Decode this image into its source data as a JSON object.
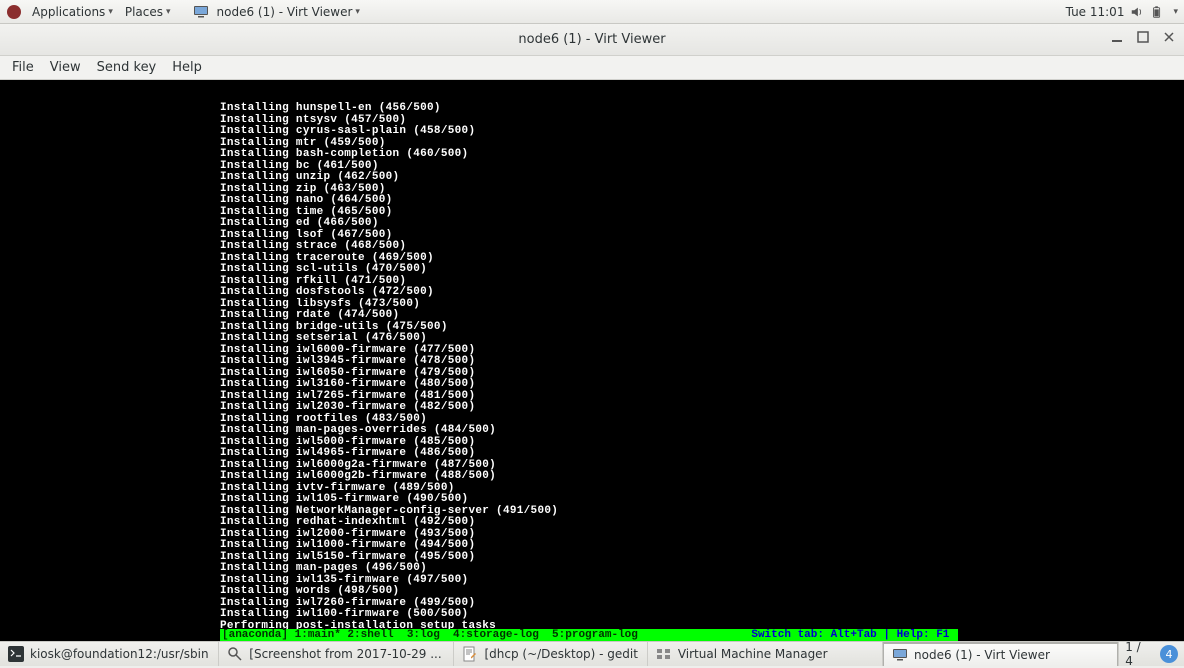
{
  "top_panel": {
    "applications": "Applications",
    "places": "Places",
    "running_window": "node6 (1) - Virt Viewer",
    "clock": "Tue 11:01"
  },
  "window": {
    "title": "node6 (1) - Virt Viewer",
    "menus": [
      "File",
      "View",
      "Send key",
      "Help"
    ]
  },
  "console": {
    "lines": [
      "Installing hunspell-en (456/500)",
      "Installing ntsysv (457/500)",
      "Installing cyrus-sasl-plain (458/500)",
      "Installing mtr (459/500)",
      "Installing bash-completion (460/500)",
      "Installing bc (461/500)",
      "Installing unzip (462/500)",
      "Installing zip (463/500)",
      "Installing nano (464/500)",
      "Installing time (465/500)",
      "Installing ed (466/500)",
      "Installing lsof (467/500)",
      "Installing strace (468/500)",
      "Installing traceroute (469/500)",
      "Installing scl-utils (470/500)",
      "Installing rfkill (471/500)",
      "Installing dosfstools (472/500)",
      "Installing libsysfs (473/500)",
      "Installing rdate (474/500)",
      "Installing bridge-utils (475/500)",
      "Installing setserial (476/500)",
      "Installing iwl6000-firmware (477/500)",
      "Installing iwl3945-firmware (478/500)",
      "Installing iwl6050-firmware (479/500)",
      "Installing iwl3160-firmware (480/500)",
      "Installing iwl7265-firmware (481/500)",
      "Installing iwl2030-firmware (482/500)",
      "Installing rootfiles (483/500)",
      "Installing man-pages-overrides (484/500)",
      "Installing iwl5000-firmware (485/500)",
      "Installing iwl4965-firmware (486/500)",
      "Installing iwl6000g2a-firmware (487/500)",
      "Installing iwl6000g2b-firmware (488/500)",
      "Installing ivtv-firmware (489/500)",
      "Installing iwl105-firmware (490/500)",
      "Installing NetworkManager-config-server (491/500)",
      "Installing redhat-indexhtml (492/500)",
      "Installing iwl2000-firmware (493/500)",
      "Installing iwl1000-firmware (494/500)",
      "Installing iwl5150-firmware (495/500)",
      "Installing man-pages (496/500)",
      "Installing iwl135-firmware (497/500)",
      "Installing words (498/500)",
      "Installing iwl7260-firmware (499/500)",
      "Installing iwl100-firmware (500/500)",
      "Performing post-installation setup tasks"
    ],
    "statusbar_left": "[anaconda] 1:main* 2:shell  3:log  4:storage-log  5:program-log",
    "statusbar_right": "Switch tab: Alt+Tab | Help: F1 "
  },
  "taskbar": {
    "items": [
      {
        "label": "kiosk@foundation12:/usr/sbin",
        "icon": "terminal-icon"
      },
      {
        "label": "[Screenshot from 2017-10-29 ...",
        "icon": "image-viewer-icon"
      },
      {
        "label": "[dhcp (~/Desktop) - gedit",
        "icon": "gedit-icon"
      },
      {
        "label": "Virtual Machine Manager",
        "icon": "virt-manager-icon"
      },
      {
        "label": "node6 (1) - Virt Viewer",
        "icon": "monitor-icon",
        "active": true
      }
    ],
    "workspace": {
      "label": "1 / 4",
      "badge": "4"
    }
  }
}
